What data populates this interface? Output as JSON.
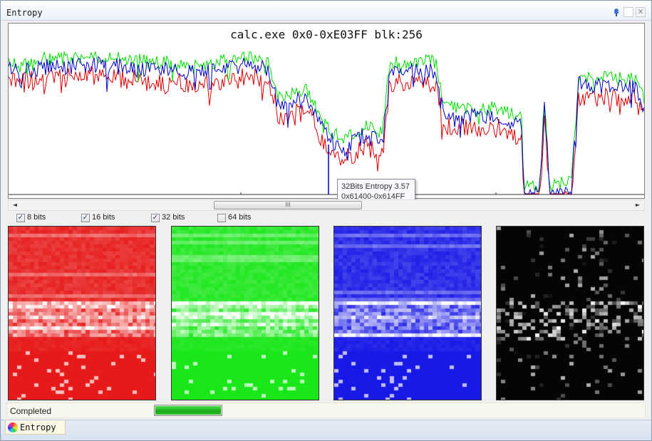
{
  "window": {
    "title": "Entropy",
    "pin_icon": "pin-icon",
    "maximize_icon": "maximize-icon",
    "close_icon": "close-icon"
  },
  "graph": {
    "title": "calc.exe 0x0-0xE03FF blk:256",
    "tooltip_line1": "32Bits Entropy 3.57",
    "tooltip_line2": "0x61400-0x614FF",
    "colors": {
      "8bits": "#dd0000",
      "16bits": "#00dd00",
      "32bits": "#0000cc"
    }
  },
  "scrollbar": {
    "left_arrow": "◄",
    "right_arrow": "►",
    "thumb_grip": "III",
    "position": 0.29,
    "visible_fraction": 0.24
  },
  "checkboxes": [
    {
      "label": "8 bits",
      "checked": true
    },
    {
      "label": "16 bits",
      "checked": true
    },
    {
      "label": "32 bits",
      "checked": true
    },
    {
      "label": "64 bits",
      "checked": false
    }
  ],
  "heatmaps": [
    {
      "name": "8 bits",
      "color": "#ff0000"
    },
    {
      "name": "16 bits",
      "color": "#00ff00"
    },
    {
      "name": "32 bits",
      "color": "#0000ff"
    },
    {
      "name": "64 bits",
      "color": "#000000"
    }
  ],
  "status": {
    "text": "Completed",
    "progress": 1.0
  },
  "tabs": [
    {
      "label": "Entropy",
      "icon": "color-wheel-icon"
    }
  ]
}
